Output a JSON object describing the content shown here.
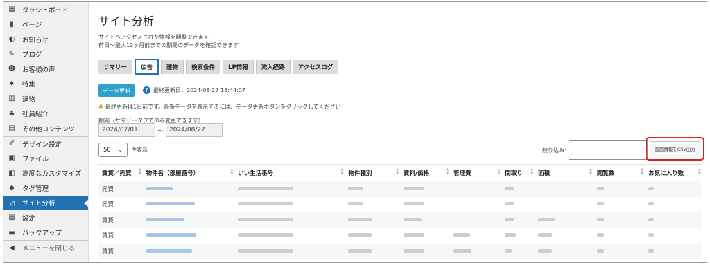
{
  "sidebar": {
    "items": [
      {
        "label": "ダッシュボード",
        "icon": "dashboard-icon",
        "glyph": "▦"
      },
      {
        "label": "ページ",
        "icon": "pages-icon",
        "glyph": "▮"
      },
      {
        "label": "お知らせ",
        "icon": "megaphone-icon",
        "glyph": "◐"
      },
      {
        "label": "ブログ",
        "icon": "pencil-icon",
        "glyph": "✎"
      },
      {
        "label": "お客様の声",
        "icon": "people-icon",
        "glyph": "☻"
      },
      {
        "label": "特集",
        "icon": "lightbulb-icon",
        "glyph": "♦"
      },
      {
        "label": "建物",
        "icon": "building-icon",
        "glyph": "▥"
      },
      {
        "label": "社員紹介",
        "icon": "users-icon",
        "glyph": "♣"
      },
      {
        "label": "その他コンテンツ",
        "icon": "document-icon",
        "glyph": "▤"
      },
      {
        "label": "デザイン設定",
        "icon": "brush-icon",
        "glyph": "✐"
      },
      {
        "label": "ファイル",
        "icon": "media-icon",
        "glyph": "▣"
      },
      {
        "label": "高度なカスタマイズ",
        "icon": "code-icon",
        "glyph": "◧"
      },
      {
        "label": "タグ管理",
        "icon": "tag-icon",
        "glyph": "◆"
      },
      {
        "label": "サイト分析",
        "icon": "chart-icon",
        "glyph": "◿",
        "active": true
      },
      {
        "label": "設定",
        "icon": "settings-icon",
        "glyph": "▦"
      },
      {
        "label": "バックアップ",
        "icon": "archive-icon",
        "glyph": "▬"
      },
      {
        "label": "メニューを閉じる",
        "icon": "collapse-icon",
        "glyph": "◀"
      }
    ]
  },
  "header": {
    "title": "サイト分析",
    "desc1": "サイトへアクセスされた情報を閲覧できます",
    "desc2": "前日～最大12ヶ月前までの期間のデータを確認できます"
  },
  "tabs": [
    {
      "label": "サマリー"
    },
    {
      "label": "広告",
      "active": true
    },
    {
      "label": "建物"
    },
    {
      "label": "検索条件"
    },
    {
      "label": "LP情報"
    },
    {
      "label": "流入経路"
    },
    {
      "label": "アクセスログ"
    }
  ],
  "controls": {
    "update_button": "データ更新",
    "last_update": "最終更新日：2024-08-27 18:44:07",
    "warning": "最終更新は1日前です。最新データを表示するには、データ更新ボタンをクリックしてください",
    "period_label": "期間（サマリータブでのみ変更できます）",
    "date_from": "2024/07/01",
    "date_sep": "〜",
    "date_to": "2024/08/27",
    "per_page": "50",
    "per_page_label": "件表示",
    "filter_label": "絞り込み:",
    "filter_value": "",
    "csv_button": "画面情報をCSV出力"
  },
  "table": {
    "columns": [
      "賃貸／売買",
      "物件名（部屋番号）",
      "いい生活番号",
      "物件種別",
      "賃料/価格",
      "管理費",
      "間取り",
      "面積",
      "閲覧数",
      "お気に入り数"
    ],
    "rows": [
      {
        "type": "売買"
      },
      {
        "type": "売買"
      },
      {
        "type": "賃貸"
      },
      {
        "type": "賃貸"
      },
      {
        "type": "賃貸"
      }
    ]
  },
  "colors": {
    "accent": "#2271b1",
    "update_button": "#2ea2cc",
    "highlight_border": "#e01e1e"
  }
}
